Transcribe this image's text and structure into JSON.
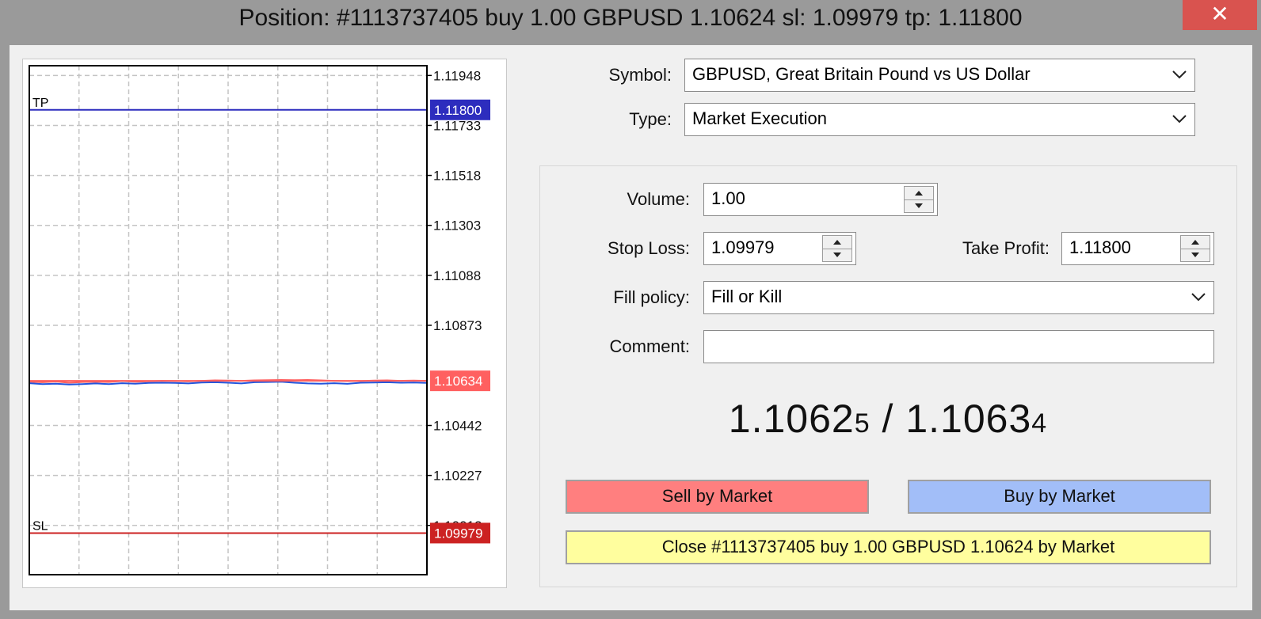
{
  "window": {
    "title": "Position: #1113737405 buy 1.00 GBPUSD 1.10624 sl: 1.09979 tp: 1.11800",
    "close_glyph": "✕"
  },
  "form": {
    "symbol_label": "Symbol:",
    "symbol_value": "GBPUSD, Great Britain Pound vs US Dollar",
    "type_label": "Type:",
    "type_value": "Market Execution",
    "volume_label": "Volume:",
    "volume_value": "1.00",
    "stop_loss_label": "Stop Loss:",
    "stop_loss_value": "1.09979",
    "take_profit_label": "Take Profit:",
    "take_profit_value": "1.11800",
    "fill_policy_label": "Fill policy:",
    "fill_policy_value": "Fill or Kill",
    "comment_label": "Comment:",
    "comment_value": ""
  },
  "quote": {
    "bid_main": "1.1062",
    "bid_small": "5",
    "separator": " / ",
    "ask_main": "1.1063",
    "ask_small": "4"
  },
  "buttons": {
    "sell": "Sell by Market",
    "buy": "Buy by Market",
    "close": "Close #1113737405 buy 1.00 GBPUSD 1.10624 by Market"
  },
  "colors": {
    "tp": "#2d2dbe",
    "sl": "#cc2222",
    "price": "#ff6060",
    "bid_line": "#2255dd",
    "sell_btn": "#ff7f7f",
    "buy_btn": "#a2bef8",
    "close_btn": "#fffe9e"
  },
  "chart_data": {
    "type": "line",
    "y_ticks": [
      "1.11948",
      "1.11733",
      "1.11518",
      "1.11303",
      "1.11088",
      "1.10873",
      "1.10442",
      "1.10227",
      "1.10012"
    ],
    "y_tick_values": [
      1.11948,
      1.11733,
      1.11518,
      1.11303,
      1.11088,
      1.10873,
      1.10442,
      1.10227,
      1.10012
    ],
    "ylim": [
      1.098,
      1.1199
    ],
    "grid": true,
    "levels": [
      {
        "name": "TP",
        "value": 1.118,
        "label": "1.11800",
        "color": "#2d2dbe"
      },
      {
        "name": "SL",
        "value": 1.09979,
        "label": "1.09979",
        "color": "#cc2222"
      },
      {
        "name": "",
        "value": 1.10634,
        "label": "1.10634",
        "color": "#ff6060"
      }
    ],
    "series": [
      {
        "color": "#ff6060",
        "values": [
          1.1063,
          1.10628,
          1.10631,
          1.10626,
          1.10629,
          1.1063,
          1.10629,
          1.10633,
          1.1063,
          1.10632,
          1.10634,
          1.10633,
          1.10632,
          1.10634,
          1.10636,
          1.10635,
          1.10634,
          1.10636,
          1.10637,
          1.10638,
          1.10637,
          1.10638,
          1.10636,
          1.10634,
          1.10633,
          1.10633,
          1.10635,
          1.10636,
          1.10634,
          1.10635,
          1.10634
        ]
      },
      {
        "color": "#2255dd",
        "values": [
          1.10624,
          1.1062,
          1.10622,
          1.10618,
          1.1062,
          1.10623,
          1.1062,
          1.10624,
          1.10622,
          1.10625,
          1.10626,
          1.10625,
          1.10623,
          1.10627,
          1.10628,
          1.10626,
          1.10623,
          1.10628,
          1.10629,
          1.1063,
          1.10626,
          1.10623,
          1.10622,
          1.10624,
          1.10621,
          1.10626,
          1.10627,
          1.10628,
          1.10626,
          1.10627,
          1.10625
        ]
      }
    ]
  }
}
